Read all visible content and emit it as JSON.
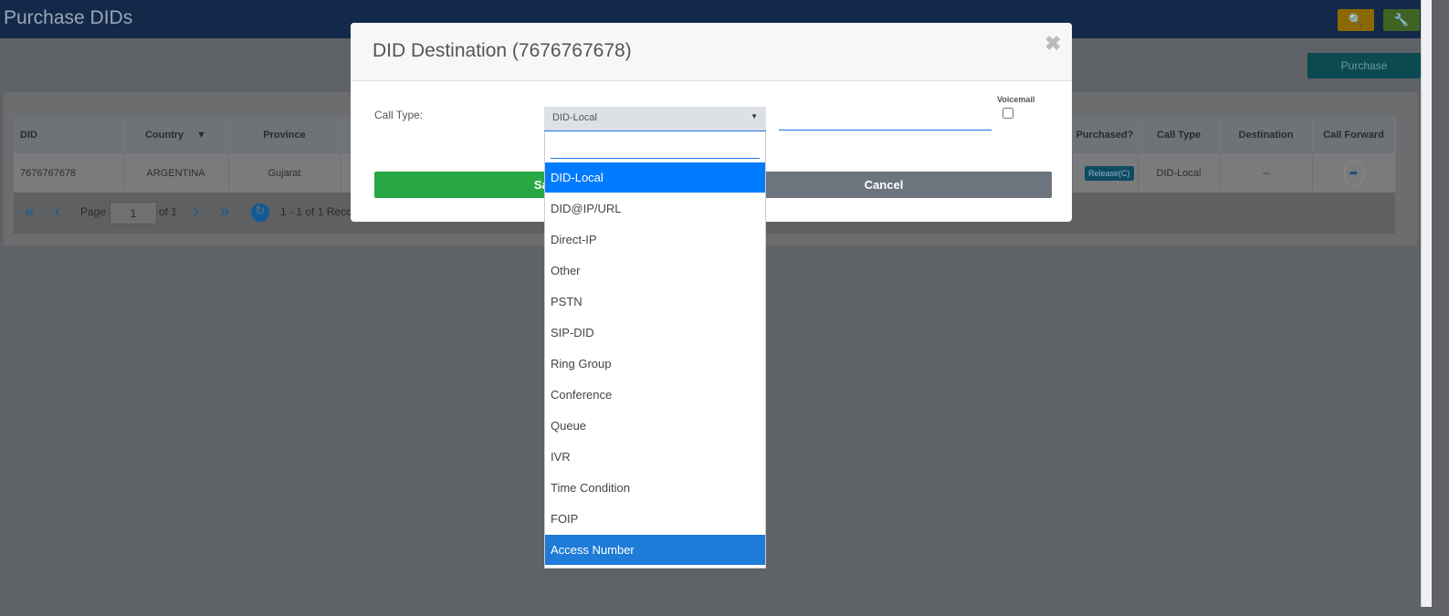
{
  "page": {
    "title": "Purchase DIDs",
    "purchase_label": "Purchase",
    "icons": {
      "search": "search-icon",
      "settings": "wrench-icon"
    }
  },
  "table": {
    "headers": [
      "DID",
      "Country",
      "Province",
      "Purchased?",
      "Call Type",
      "Destination",
      "Call Forward"
    ],
    "rows": [
      {
        "did": "7676767678",
        "country": "ARGENTINA",
        "province": "Gujarat",
        "purchased_badge": "Release(C)",
        "call_type": "DID-Local",
        "destination": "--"
      }
    ]
  },
  "pager": {
    "page_label": "Page",
    "page_value": "1",
    "of_label": "of 1",
    "records": "1 - 1 of 1 Records"
  },
  "modal": {
    "title": "DID Destination (7676767678)",
    "call_type_label": "Call Type:",
    "call_type_value": "DID-Local",
    "destination_value": "",
    "voicemail_label": "Voicemail",
    "voicemail_checked": false,
    "save_label": "Save",
    "cancel_label": "Cancel",
    "search_value": "",
    "options": [
      "DID-Local",
      "DID@IP/URL",
      "Direct-IP",
      "Other",
      "PSTN",
      "SIP-DID",
      "Ring Group",
      "Conference",
      "Queue",
      "IVR",
      "Time Condition",
      "FOIP",
      "Access Number"
    ],
    "selected_option": "DID-Local",
    "hovered_option": "Access Number"
  },
  "colors": {
    "header": "#24528f",
    "save": "#28a745",
    "cancel": "#6c757d",
    "selected": "#007bff",
    "hover": "#1e7bd8"
  }
}
